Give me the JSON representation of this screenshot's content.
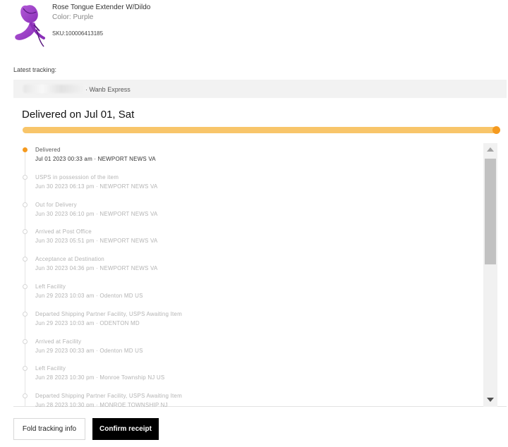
{
  "product": {
    "title": "Rose Tongue  Extender W/Dildo",
    "color": "Color:  Purple",
    "sku": "SKU:100006413185",
    "thumbnail_icon": "purple-rose-toy-thumbnail",
    "thumbnail_colors": [
      "#8a2fb8",
      "#b35ad8",
      "#5b1a80"
    ]
  },
  "tracking": {
    "latest_label": "Latest tracking:",
    "carrier_separator": "·",
    "carrier": "Wanb  Express",
    "delivered_heading": "Delivered on Jul 01, Sat",
    "progress": 1.0,
    "progress_color": "#f8c56a",
    "progress_dot_color": "#f59a1f",
    "events": [
      {
        "status": "Delivered",
        "datetime": "Jul 01 2023 00:33 am",
        "location": "NEWPORT  NEWS VA",
        "latest": true
      },
      {
        "status": "USPS in  possession of the item",
        "datetime": "Jun 30 2023 06:13 pm",
        "location": "NEWPORT  NEWS VA",
        "latest": false
      },
      {
        "status": "Out for  Delivery",
        "datetime": "Jun 30 2023 06:10 pm",
        "location": "NEWPORT  NEWS VA",
        "latest": false
      },
      {
        "status": "Arrived at  Post Office",
        "datetime": "Jun 30 2023 05:51 pm",
        "location": "NEWPORT  NEWS VA",
        "latest": false
      },
      {
        "status": "Acceptance at  Destination",
        "datetime": "Jun 30 2023 04:36 pm",
        "location": "NEWPORT  NEWS VA",
        "latest": false
      },
      {
        "status": "Left  Facility",
        "datetime": "Jun 29 2023 10:03 am",
        "location": "Odenton  MD US",
        "latest": false
      },
      {
        "status": "Departed Shipping  Partner  Facility, USPS Awaiting  Item",
        "datetime": "Jun 29 2023 10:03 am",
        "location": "ODENTON  MD",
        "latest": false
      },
      {
        "status": "Arrived at  Facility",
        "datetime": "Jun 29 2023 00:33 am",
        "location": "Odenton  MD US",
        "latest": false
      },
      {
        "status": "Left  Facility",
        "datetime": "Jun 28 2023 10:30 pm",
        "location": "Monroe Township  NJ US",
        "latest": false
      },
      {
        "status": "Departed Shipping  Partner  Facility, USPS Awaiting  Item",
        "datetime": "Jun 28 2023 10:30 pm",
        "location": "MONROE TOWNSHIP  NJ",
        "latest": false
      }
    ]
  },
  "actions": {
    "fold_label": "Fold tracking info",
    "confirm_label": "Confirm receipt"
  },
  "icons": {
    "scroll_up": "scroll-up-arrow-icon",
    "scroll_down": "scroll-down-arrow-icon"
  }
}
